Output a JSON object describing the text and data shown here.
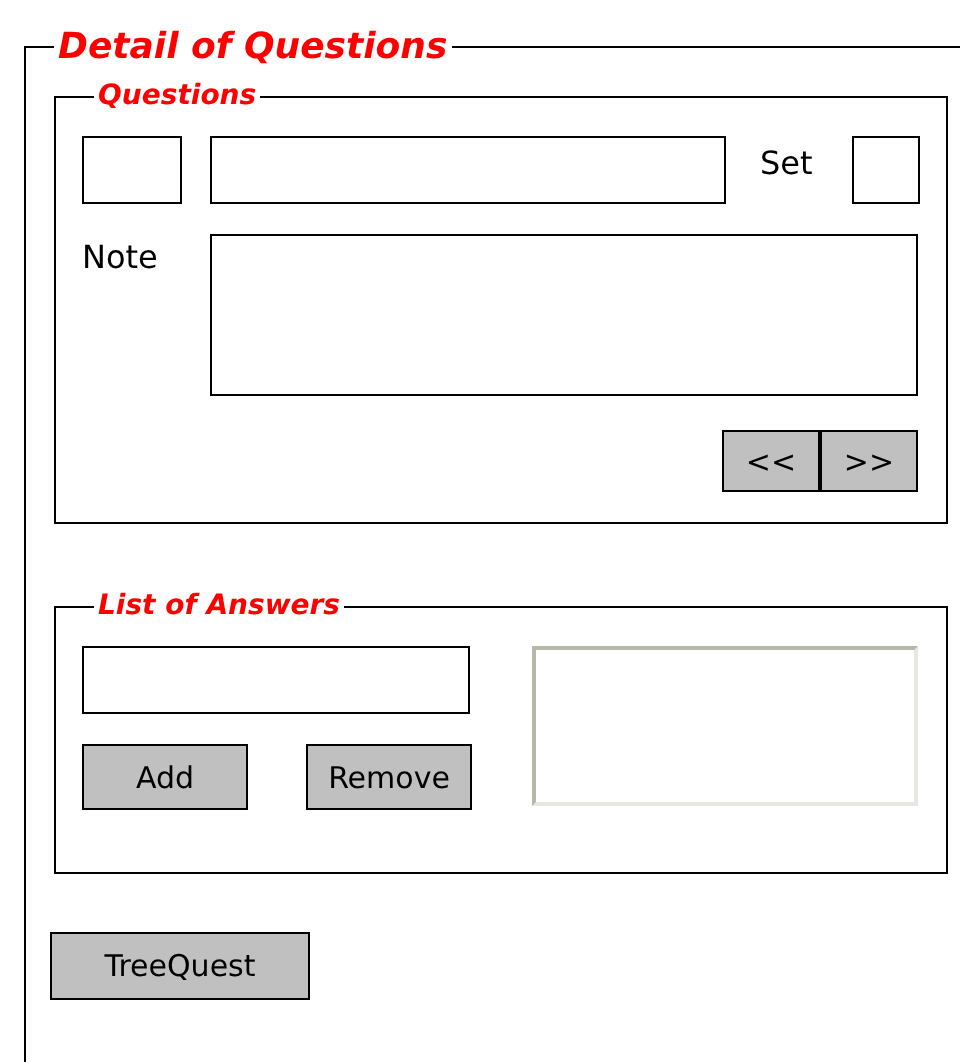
{
  "section": {
    "title": "Detail of Questions"
  },
  "questions": {
    "title": "Questions",
    "set_label": "Set",
    "note_label": "Note",
    "buttons": [
      "<<",
      ">>"
    ]
  },
  "answers": {
    "title": "List of Answers",
    "buttons": [
      "Add",
      "Remove"
    ]
  },
  "tree_button": "TreeQuest"
}
